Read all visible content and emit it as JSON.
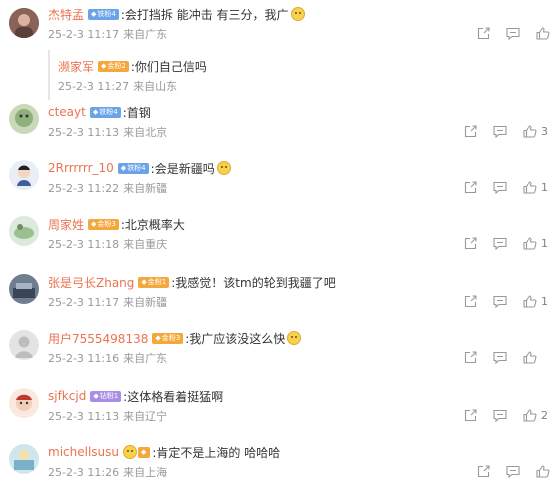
{
  "comments": [
    {
      "user": "杰特孟",
      "badge": "铁粉4",
      "badge_color": "#6aa3e8",
      "text": ":会打挡拆 能冲击 有三分，我广",
      "emoji": true,
      "date": "25-2-3 11:17",
      "location": "来自广东",
      "like_count": "",
      "avatar_color": "#b57a6e",
      "reply": {
        "user": "濒家军",
        "badge": "金粉2",
        "badge_color": "#f4a83c",
        "text": ":你们自己信吗",
        "date": "25-2-3 11:27",
        "location": "来自山东"
      }
    },
    {
      "user": "cteayt",
      "badge": "铁粉4",
      "badge_color": "#6aa3e8",
      "text": ":首钢",
      "emoji": false,
      "date": "25-2-3 11:13",
      "location": "来自北京",
      "like_count": "3",
      "avatar_color": "#8fb07a"
    },
    {
      "user": "2Rrrrrrr_10",
      "badge": "铁粉4",
      "badge_color": "#6aa3e8",
      "text": ":会是新疆吗",
      "emoji": true,
      "date": "25-2-3 11:22",
      "location": "来自新疆",
      "like_count": "1",
      "avatar_color": "#3f5d9a"
    },
    {
      "user": "周家姓",
      "badge": "金粉3",
      "badge_color": "#f4a83c",
      "text": ":北京概率大",
      "emoji": false,
      "date": "25-2-3 11:18",
      "location": "来自重庆",
      "like_count": "1",
      "avatar_color": "#9bc08f"
    },
    {
      "user": "张是弓长Zhang",
      "badge": "金粉1",
      "badge_color": "#f4a83c",
      "text": ":我感觉！该tm的轮到我疆了吧",
      "emoji": false,
      "date": "25-2-3 11:17",
      "location": "来自新疆",
      "like_count": "1",
      "avatar_color": "#4a5870"
    },
    {
      "user": "用户7555498138",
      "badge": "金粉3",
      "badge_color": "#f4a83c",
      "text": ":我广应该没这么快",
      "emoji": true,
      "date": "25-2-3 11:16",
      "location": "来自广东",
      "like_count": "",
      "avatar_color": "#d4d4d4"
    },
    {
      "user": "sjfkcjd",
      "badge": "钻粉1",
      "badge_color": "#a98ee8",
      "text": ":这体格看着挺猛啊",
      "emoji": false,
      "date": "25-2-3 11:13",
      "location": "来自辽宁",
      "like_count": "2",
      "avatar_color": "#e8c3b0"
    },
    {
      "user": "michellsusu",
      "badge": "",
      "badge_color": "#f4a83c",
      "text": ":肯定不是上海的 哈哈哈",
      "emoji": false,
      "date": "25-2-3 11:26",
      "location": "来自上海",
      "like_count": "",
      "avatar_color": "#7ab0c8"
    }
  ]
}
